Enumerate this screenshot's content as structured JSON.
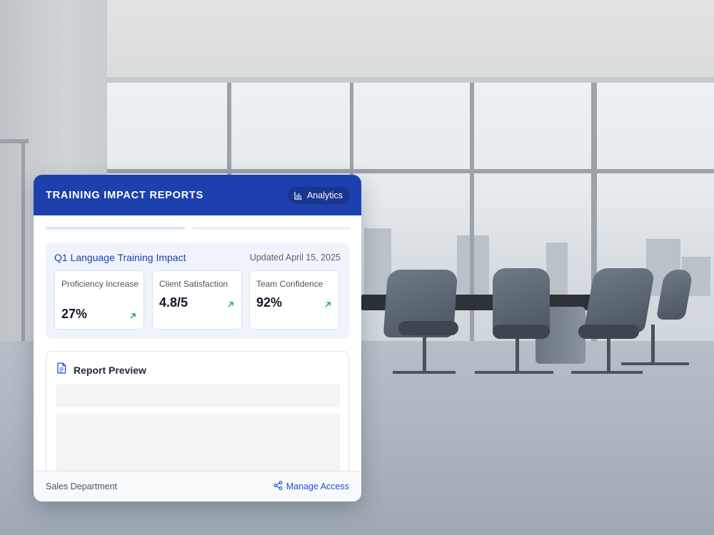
{
  "header": {
    "title": "TRAINING IMPACT REPORTS",
    "analytics_label": "Analytics",
    "analytics_icon": "bar-chart-icon"
  },
  "impact": {
    "title": "Q1 Language Training Impact",
    "updated": "Updated April 15, 2025",
    "metrics": [
      {
        "label": "Proficiency Increase",
        "value": "27%",
        "trend": "up",
        "trend_icon": "arrow-up-right-icon"
      },
      {
        "label": "Client Satisfaction",
        "value": "4.8/5",
        "trend": "up",
        "trend_icon": "arrow-up-right-icon"
      },
      {
        "label": "Team Confidence",
        "value": "92%",
        "trend": "up",
        "trend_icon": "arrow-up-right-icon"
      }
    ]
  },
  "preview": {
    "title": "Report Preview",
    "icon": "document-icon"
  },
  "footer": {
    "department": "Sales Department",
    "manage_label": "Manage Access",
    "manage_icon": "share-icon"
  },
  "colors": {
    "header_bg": "#1d40af",
    "accent": "#1d4ed8",
    "trend_up": "#16a34a",
    "panel_bg": "#eef3fc"
  }
}
